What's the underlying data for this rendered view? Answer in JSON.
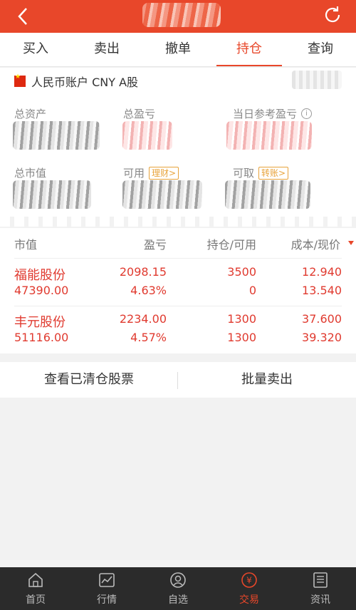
{
  "tabs": [
    {
      "label": "买入",
      "active": false
    },
    {
      "label": "卖出",
      "active": false
    },
    {
      "label": "撤单",
      "active": false
    },
    {
      "label": "持仓",
      "active": true
    },
    {
      "label": "查询",
      "active": false
    }
  ],
  "account": {
    "name": "人民币账户 CNY A股",
    "stats": {
      "total_assets_label": "总资产",
      "total_pnl_label": "总盈亏",
      "daily_pnl_label": "当日参考盈亏",
      "market_value_label": "总市值",
      "available_label": "可用",
      "available_tag": "理财>",
      "withdrawable_label": "可取",
      "withdrawable_tag": "转账>"
    }
  },
  "holdings": {
    "headers": [
      "市值",
      "盈亏",
      "持仓/可用",
      "成本/现价"
    ],
    "rows": [
      {
        "name": "福能股份",
        "market_value": "47390.00",
        "pnl": "2098.15",
        "pnl_pct": "4.63%",
        "position": "3500",
        "available": "0",
        "cost": "12.940",
        "price": "13.540"
      },
      {
        "name": "丰元股份",
        "market_value": "51116.00",
        "pnl": "2234.00",
        "pnl_pct": "4.57%",
        "position": "1300",
        "available": "1300",
        "cost": "37.600",
        "price": "39.320"
      }
    ]
  },
  "actions": {
    "view_cleared": "查看已清仓股票",
    "batch_sell": "批量卖出"
  },
  "tabbar": [
    {
      "label": "首页",
      "icon": "home-icon",
      "active": false
    },
    {
      "label": "行情",
      "icon": "chart-icon",
      "active": false
    },
    {
      "label": "自选",
      "icon": "watchlist-icon",
      "active": false
    },
    {
      "label": "交易",
      "icon": "trade-icon",
      "active": true
    },
    {
      "label": "资讯",
      "icon": "news-icon",
      "active": false
    }
  ],
  "colors": {
    "accent": "#e8472a",
    "up": "#e03a2f",
    "tag": "#e8a33b"
  }
}
